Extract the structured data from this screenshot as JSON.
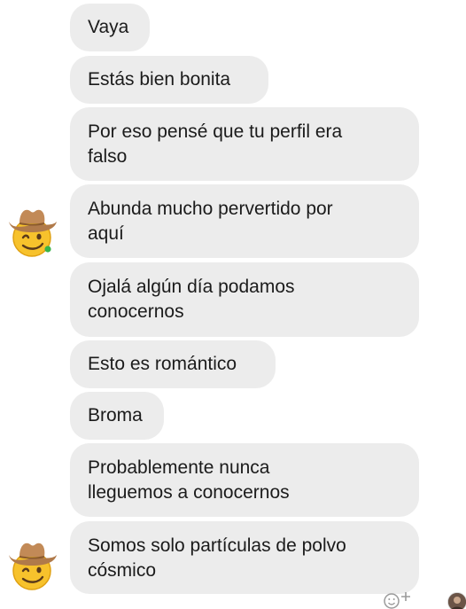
{
  "messages": [
    {
      "lines": [
        "Vaya"
      ]
    },
    {
      "lines": [
        "Estás bien bonita"
      ]
    },
    {
      "lines": [
        "Por eso pensé que tu perfil era",
        "falso"
      ]
    },
    {
      "lines": [
        "Abunda mucho pervertido por",
        "aquí"
      ]
    },
    {
      "lines": [
        "Ojalá algún día podamos",
        "conocernos"
      ]
    },
    {
      "lines": [
        "Esto es romántico"
      ]
    },
    {
      "lines": [
        "Broma"
      ]
    },
    {
      "lines": [
        "Probablemente nunca",
        "lleguemos a conocernos"
      ]
    },
    {
      "lines": [
        "Somos solo partículas de polvo",
        "cósmico"
      ]
    }
  ],
  "avatars": [
    {
      "icon": "cowboy-emoji-icon"
    },
    {
      "icon": "cowboy-emoji-icon"
    }
  ],
  "colors": {
    "bubble": "#ececec",
    "text": "#1b1b1b",
    "background": "#ffffff"
  }
}
